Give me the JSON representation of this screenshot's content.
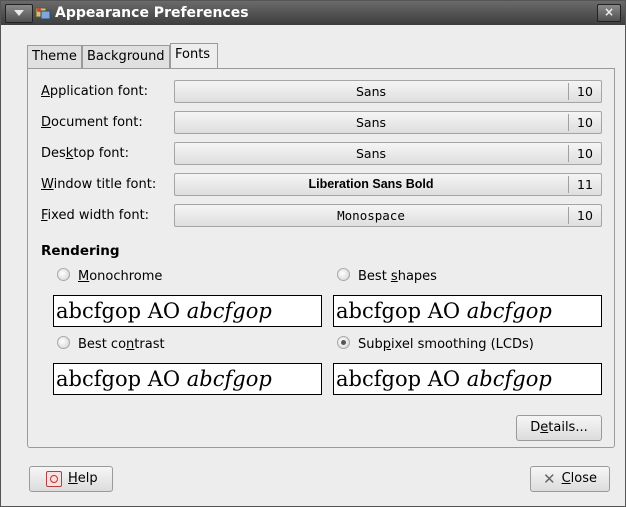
{
  "window": {
    "title": "Appearance Preferences",
    "close_glyph": "×"
  },
  "tabs": [
    {
      "label": "Theme",
      "active": false
    },
    {
      "label": "Background",
      "active": false
    },
    {
      "label": "Fonts",
      "active": true
    }
  ],
  "fonts": [
    {
      "label_pre": "",
      "label_u": "A",
      "label_post": "pplication font:",
      "font": "Sans",
      "size": "10",
      "bold": false
    },
    {
      "label_pre": "",
      "label_u": "D",
      "label_post": "ocument font:",
      "font": "Sans",
      "size": "10",
      "bold": false
    },
    {
      "label_pre": "Des",
      "label_u": "k",
      "label_post": "top font:",
      "font": "Sans",
      "size": "10",
      "bold": false
    },
    {
      "label_pre": "",
      "label_u": "W",
      "label_post": "indow title font:",
      "font": "Liberation Sans Bold",
      "size": "11",
      "bold": true
    },
    {
      "label_pre": "",
      "label_u": "F",
      "label_post": "ixed width font:",
      "font": "Monospace",
      "size": "10",
      "bold": false
    }
  ],
  "rendering": {
    "title": "Rendering",
    "options": [
      {
        "pre": "",
        "u": "M",
        "post": "onochrome",
        "checked": false
      },
      {
        "pre": "Best ",
        "u": "s",
        "post": "hapes",
        "checked": false
      },
      {
        "pre": "Best co",
        "u": "n",
        "post": "trast",
        "checked": false
      },
      {
        "pre": "Sub",
        "u": "p",
        "post": "ixel smoothing (LCDs)",
        "checked": true
      }
    ],
    "sample_text": {
      "regular": "abcfgop AO ",
      "italic": "abcfgop"
    }
  },
  "buttons": {
    "details": {
      "pre": "D",
      "u": "e",
      "post": "tails..."
    },
    "help": {
      "pre": "",
      "u": "H",
      "post": "elp"
    },
    "close": {
      "pre": "",
      "u": "C",
      "post": "lose"
    }
  }
}
